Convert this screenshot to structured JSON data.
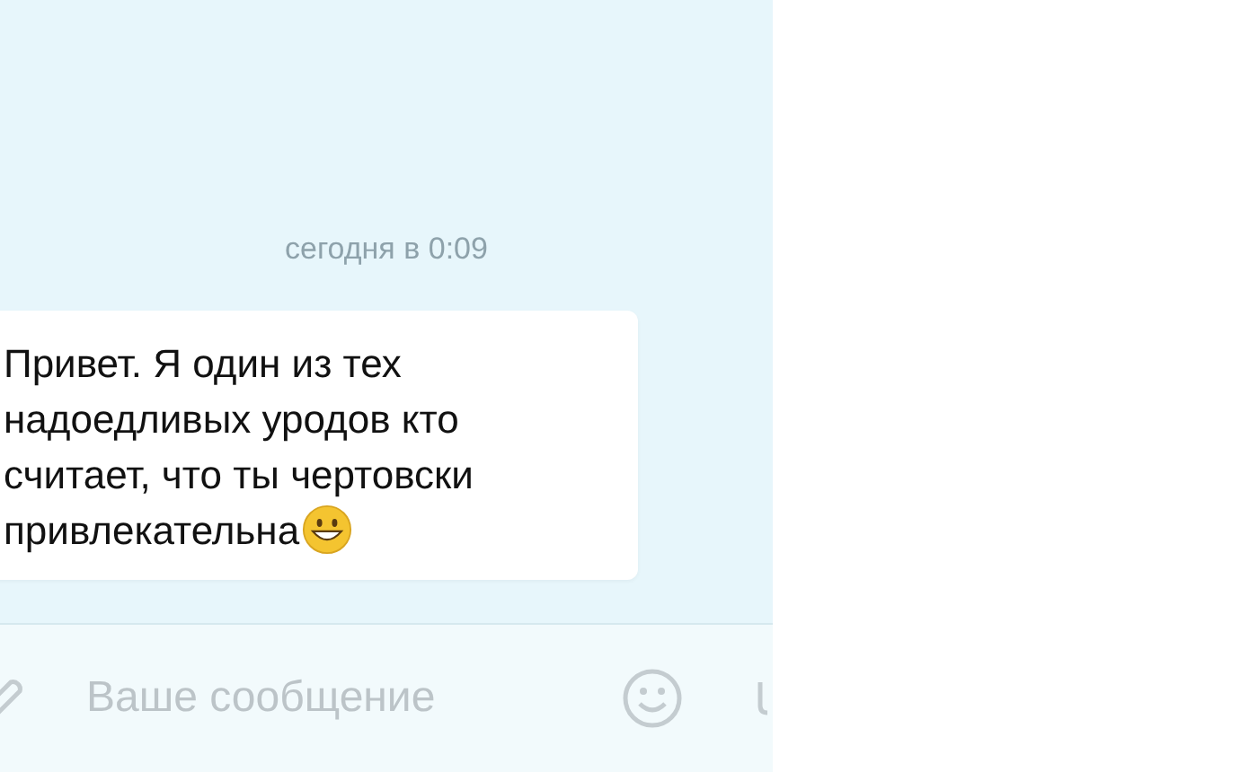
{
  "chat": {
    "timestamp": "сегодня в 0:09",
    "messages": [
      {
        "text": "Привет. Я один из тех надоедливых уродов кто считает, что ты чертовски привлекательна",
        "emoji": true
      }
    ]
  },
  "composer": {
    "placeholder": "Ваше сообщение"
  }
}
